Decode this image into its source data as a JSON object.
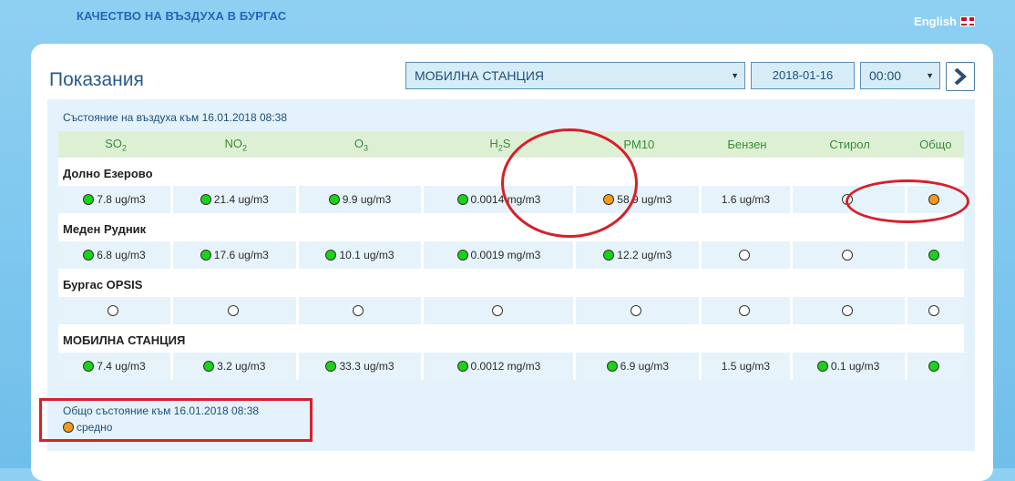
{
  "site": {
    "title": "КАЧЕСТВО НА ВЪЗДУХА В БУРГАС",
    "language_label": "English",
    "language_icon": "uk-flag-icon"
  },
  "page": {
    "title": "Показания"
  },
  "controls": {
    "station": "МОБИЛНА СТАНЦИЯ",
    "date": "2018-01-16",
    "time": "00:00",
    "caret": "▼",
    "next_icon": "chevron-right-icon"
  },
  "status": {
    "heading": "Състояние на въздуха към 16.01.2018 08:38",
    "columns": [
      {
        "main": "SO",
        "sub": "2"
      },
      {
        "main": "NO",
        "sub": "2"
      },
      {
        "main": "O",
        "sub": "3"
      },
      {
        "main": "H",
        "sub": "2",
        "tail": "S"
      },
      {
        "main": "PM10",
        "sub": ""
      },
      {
        "main": "Бензен",
        "sub": ""
      },
      {
        "main": "Стирол",
        "sub": ""
      },
      {
        "main": "Общо",
        "sub": ""
      }
    ],
    "stations": [
      {
        "name": "Долно Езерово",
        "cells": [
          {
            "dot": "green",
            "value": "7.8 ug/m3"
          },
          {
            "dot": "green",
            "value": "21.4 ug/m3"
          },
          {
            "dot": "green",
            "value": "9.9 ug/m3"
          },
          {
            "dot": "green",
            "value": "0.0014 mg/m3"
          },
          {
            "dot": "orange",
            "value": "58.9 ug/m3"
          },
          {
            "dot": "none",
            "value": "1.6 ug/m3"
          },
          {
            "dot": "empty",
            "value": ""
          },
          {
            "dot": "orange",
            "value": ""
          }
        ]
      },
      {
        "name": "Меден Рудник",
        "cells": [
          {
            "dot": "green",
            "value": "6.8 ug/m3"
          },
          {
            "dot": "green",
            "value": "17.6 ug/m3"
          },
          {
            "dot": "green",
            "value": "10.1 ug/m3"
          },
          {
            "dot": "green",
            "value": "0.0019 mg/m3"
          },
          {
            "dot": "green",
            "value": "12.2 ug/m3"
          },
          {
            "dot": "empty",
            "value": ""
          },
          {
            "dot": "empty",
            "value": ""
          },
          {
            "dot": "green",
            "value": ""
          }
        ]
      },
      {
        "name": "Бургас OPSIS",
        "cells": [
          {
            "dot": "empty",
            "value": ""
          },
          {
            "dot": "empty",
            "value": ""
          },
          {
            "dot": "empty",
            "value": ""
          },
          {
            "dot": "empty",
            "value": ""
          },
          {
            "dot": "empty",
            "value": ""
          },
          {
            "dot": "empty",
            "value": ""
          },
          {
            "dot": "empty",
            "value": ""
          },
          {
            "dot": "empty",
            "value": ""
          }
        ]
      },
      {
        "name": "МОБИЛНА СТАНЦИЯ",
        "cells": [
          {
            "dot": "green",
            "value": "7.4 ug/m3"
          },
          {
            "dot": "green",
            "value": "3.2 ug/m3"
          },
          {
            "dot": "green",
            "value": "33.3 ug/m3"
          },
          {
            "dot": "green",
            "value": "0.0012 mg/m3"
          },
          {
            "dot": "green",
            "value": "6.9 ug/m3"
          },
          {
            "dot": "none",
            "value": "1.5 ug/m3"
          },
          {
            "dot": "green",
            "value": "0.1 ug/m3"
          },
          {
            "dot": "green",
            "value": ""
          }
        ]
      }
    ]
  },
  "overall": {
    "heading": "Общо състояние към 16.01.2018 08:38",
    "dot": "orange",
    "label": "средно"
  },
  "colors": {
    "green": "#17d417",
    "orange": "#f39a1a",
    "annotation": "#d6202c"
  }
}
